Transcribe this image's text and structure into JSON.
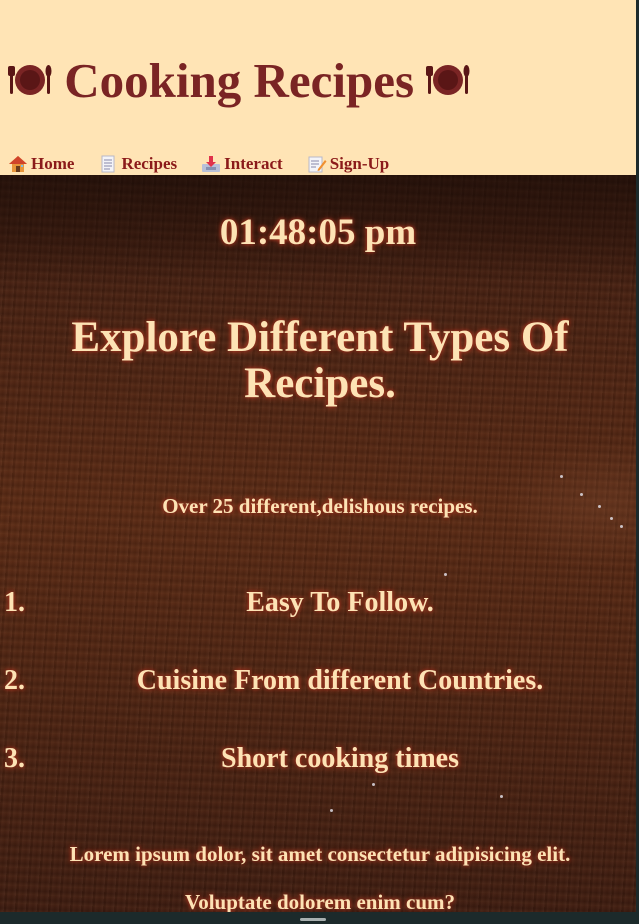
{
  "header": {
    "title": "Cooking Recipes",
    "left_icon": "plate-with-cutlery-icon",
    "right_icon": "plate-with-cutlery-icon",
    "title_color": "#7a2424",
    "background": "#ffe4b5"
  },
  "nav": {
    "items": [
      {
        "label": "Home",
        "icon": "house-icon"
      },
      {
        "label": "Recipes",
        "icon": "document-icon"
      },
      {
        "label": "Interact",
        "icon": "inbox-tray-icon"
      },
      {
        "label": "Sign-Up",
        "icon": "memo-pencil-icon"
      }
    ],
    "text_color": "#8b1a1a"
  },
  "main": {
    "clock": "01:48:05 pm",
    "headline": "Explore Different Types Of Recipes.",
    "subline": "Over 25 different,delishous recipes.",
    "features": [
      {
        "number": "1.",
        "text": "Easy To Follow."
      },
      {
        "number": "2.",
        "text": "Cuisine From different Countries."
      },
      {
        "number": "3.",
        "text": "Short cooking times"
      }
    ],
    "lorem_line1": "Lorem ipsum dolor, sit amet consectetur adipisicing elit.",
    "lorem_line2": "Voluptate dolorem enim cum?",
    "text_color": "#fde3b5"
  }
}
